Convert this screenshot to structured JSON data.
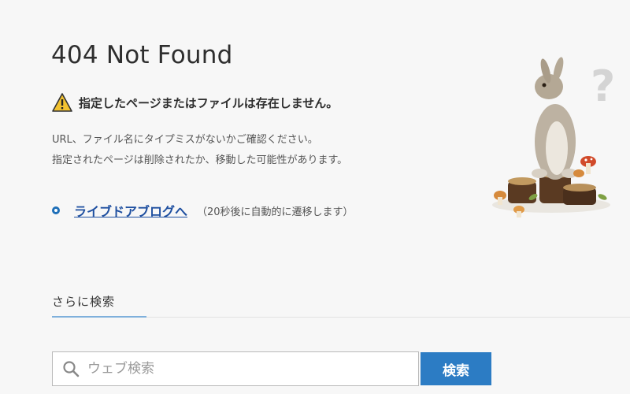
{
  "page": {
    "title": "404 Not Found",
    "warning": "指定したページまたはファイルは存在しません。",
    "description": [
      "URL、ファイル名にタイプミスがないかご確認ください。",
      "指定されたページは削除されたか、移動した可能性があります。"
    ],
    "blog_link": "ライブドアブログへ",
    "redirect_note": "（20秒後に自動的に遷移します）"
  },
  "search": {
    "heading": "さらに検索",
    "placeholder": "ウェブ検索",
    "value": "",
    "button_label": "検索"
  },
  "colors": {
    "accent": "#2c7cc4",
    "link": "#1e4fa0",
    "warning_icon": "#f2c230"
  },
  "icons": {
    "warning": "warning-icon",
    "bullet": "bullet-icon",
    "search": "search-icon"
  }
}
